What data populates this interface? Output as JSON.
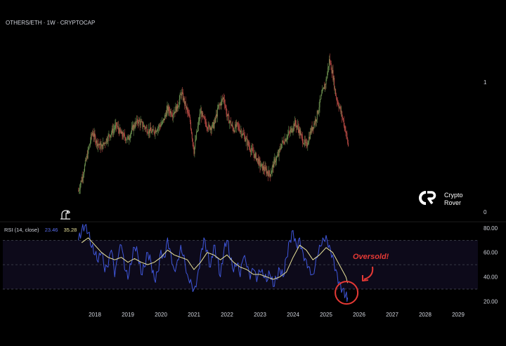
{
  "header": {
    "symbol_title": "OTHERS/ETH · 1W · CRYPTOCAP"
  },
  "logo": {
    "line1": "Crypto",
    "line2": "Rover"
  },
  "price_axis": {
    "ticks": [
      "1",
      "0"
    ]
  },
  "rsi_legend": {
    "label": "RSI (14, close)",
    "rsi_value": "23.46",
    "ma_value": "35.28"
  },
  "annotation": {
    "text": "Oversold!"
  },
  "colors": {
    "up": "#6b8f4e",
    "down": "#b84a44",
    "rsi": "#3f56d9",
    "rsi_ma": "#e8e29a",
    "annotation": "#e53935",
    "grid": "#434651",
    "text": "#d1d4dc"
  },
  "chart_data": [
    {
      "type": "candlestick",
      "title": "OTHERS/ETH · 1W · CRYPTOCAP",
      "x_ticks": [
        "2018",
        "2019",
        "2020",
        "2021",
        "2022",
        "2023",
        "2024",
        "2025",
        "2026",
        "2027",
        "2028",
        "2029"
      ],
      "y_ticks": [
        0,
        1
      ],
      "ylim": [
        0,
        1.45
      ],
      "close_path": {
        "x": [
          2017.5,
          2017.62,
          2017.78,
          2017.92,
          2018.05,
          2018.2,
          2018.35,
          2018.5,
          2018.65,
          2018.8,
          2019.0,
          2019.15,
          2019.3,
          2019.45,
          2019.6,
          2019.75,
          2019.9,
          2020.05,
          2020.2,
          2020.35,
          2020.5,
          2020.62,
          2020.75,
          2020.88,
          2021.0,
          2021.1,
          2021.2,
          2021.3,
          2021.45,
          2021.6,
          2021.75,
          2021.9,
          2022.0,
          2022.1,
          2022.2,
          2022.3,
          2022.45,
          2022.6,
          2022.75,
          2022.9,
          2023.0,
          2023.15,
          2023.3,
          2023.45,
          2023.55,
          2023.65,
          2023.8,
          2023.95,
          2024.05,
          2024.15,
          2024.25,
          2024.4,
          2024.55,
          2024.7,
          2024.85,
          2025.0,
          2025.1,
          2025.2,
          2025.3,
          2025.4,
          2025.5,
          2025.6,
          2025.68
        ],
        "y": [
          0.18,
          0.3,
          0.5,
          0.68,
          0.6,
          0.55,
          0.62,
          0.68,
          0.74,
          0.66,
          0.62,
          0.72,
          0.78,
          0.74,
          0.7,
          0.68,
          0.72,
          0.76,
          0.88,
          0.84,
          0.9,
          1.02,
          0.9,
          0.78,
          0.52,
          0.7,
          0.86,
          0.78,
          0.72,
          0.74,
          0.9,
          0.98,
          0.82,
          0.76,
          0.7,
          0.74,
          0.68,
          0.6,
          0.52,
          0.46,
          0.4,
          0.36,
          0.32,
          0.44,
          0.48,
          0.58,
          0.64,
          0.7,
          0.76,
          0.72,
          0.64,
          0.56,
          0.7,
          0.8,
          0.98,
          1.12,
          1.3,
          1.18,
          0.98,
          0.9,
          0.8,
          0.68,
          0.55
        ]
      }
    },
    {
      "type": "line",
      "title": "RSI (14, close)",
      "x_ticks": [
        "2018",
        "2019",
        "2020",
        "2021",
        "2022",
        "2023",
        "2024",
        "2025",
        "2026",
        "2027",
        "2028",
        "2029"
      ],
      "y_ticks": [
        "80.00",
        "60.00",
        "40.00",
        "20.00"
      ],
      "ylim": [
        15,
        84
      ],
      "bands": [
        70,
        50,
        30
      ],
      "series": [
        {
          "name": "RSI",
          "x": [
            2017.5,
            2017.6,
            2017.7,
            2017.8,
            2017.9,
            2018.0,
            2018.1,
            2018.2,
            2018.3,
            2018.4,
            2018.5,
            2018.6,
            2018.7,
            2018.8,
            2018.9,
            2019.0,
            2019.1,
            2019.2,
            2019.3,
            2019.4,
            2019.5,
            2019.6,
            2019.7,
            2019.8,
            2019.9,
            2020.0,
            2020.1,
            2020.2,
            2020.3,
            2020.4,
            2020.5,
            2020.6,
            2020.7,
            2020.8,
            2020.9,
            2021.0,
            2021.1,
            2021.2,
            2021.3,
            2021.4,
            2021.5,
            2021.6,
            2021.7,
            2021.8,
            2021.9,
            2022.0,
            2022.1,
            2022.2,
            2022.3,
            2022.4,
            2022.5,
            2022.6,
            2022.7,
            2022.8,
            2022.9,
            2023.0,
            2023.1,
            2023.2,
            2023.3,
            2023.4,
            2023.5,
            2023.6,
            2023.7,
            2023.8,
            2023.9,
            2024.0,
            2024.1,
            2024.2,
            2024.3,
            2024.4,
            2024.5,
            2024.6,
            2024.7,
            2024.8,
            2024.9,
            2025.0,
            2025.1,
            2025.2,
            2025.3,
            2025.4,
            2025.5,
            2025.6,
            2025.65
          ],
          "values": [
            70,
            78,
            82,
            76,
            64,
            58,
            52,
            60,
            44,
            48,
            62,
            40,
            55,
            66,
            46,
            38,
            50,
            64,
            58,
            42,
            48,
            60,
            52,
            38,
            44,
            62,
            56,
            72,
            60,
            46,
            54,
            66,
            58,
            42,
            38,
            30,
            40,
            58,
            72,
            62,
            48,
            66,
            56,
            40,
            60,
            70,
            54,
            44,
            50,
            40,
            56,
            48,
            38,
            46,
            36,
            44,
            40,
            36,
            42,
            32,
            38,
            46,
            40,
            56,
            70,
            78,
            66,
            72,
            60,
            54,
            48,
            42,
            56,
            66,
            72,
            74,
            66,
            58,
            46,
            36,
            30,
            26,
            23
          ]
        },
        {
          "name": "RSI-based MA",
          "x": [
            2017.6,
            2017.8,
            2018.0,
            2018.2,
            2018.4,
            2018.6,
            2018.8,
            2019.0,
            2019.2,
            2019.4,
            2019.6,
            2019.8,
            2020.0,
            2020.2,
            2020.4,
            2020.6,
            2020.8,
            2021.0,
            2021.2,
            2021.4,
            2021.6,
            2021.8,
            2022.0,
            2022.2,
            2022.4,
            2022.6,
            2022.8,
            2023.0,
            2023.2,
            2023.4,
            2023.6,
            2023.8,
            2024.0,
            2024.2,
            2024.4,
            2024.6,
            2024.8,
            2025.0,
            2025.2,
            2025.4,
            2025.6,
            2025.65
          ],
          "values": [
            68,
            72,
            66,
            60,
            56,
            54,
            56,
            52,
            55,
            52,
            50,
            52,
            56,
            62,
            58,
            56,
            54,
            46,
            52,
            60,
            58,
            54,
            58,
            52,
            48,
            46,
            42,
            42,
            40,
            38,
            40,
            44,
            56,
            66,
            62,
            54,
            58,
            64,
            60,
            50,
            40,
            35
          ]
        }
      ]
    }
  ]
}
